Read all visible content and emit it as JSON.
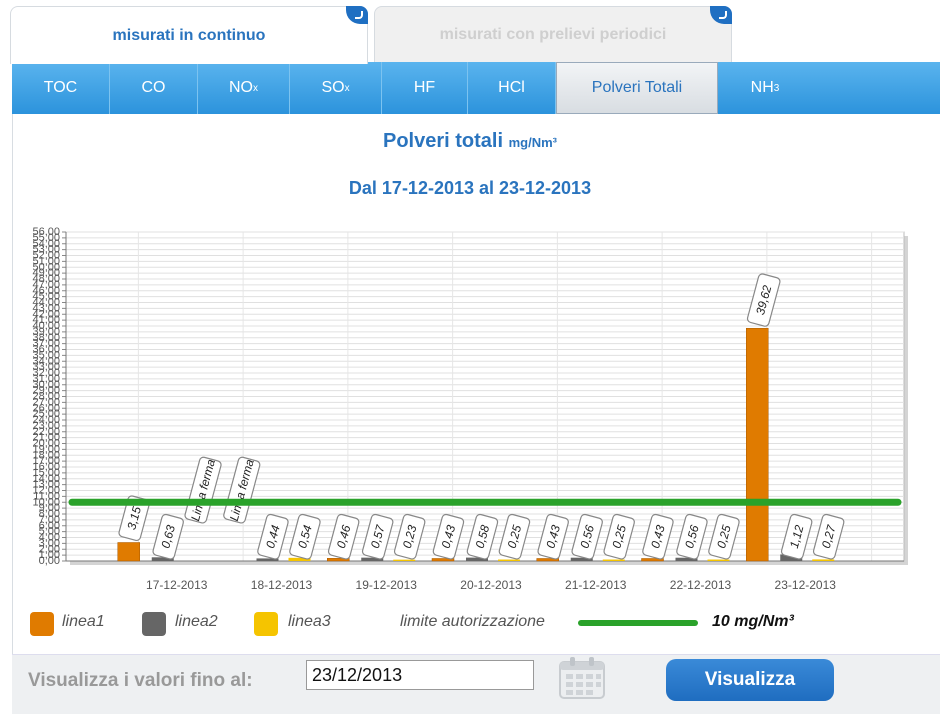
{
  "top_tabs": [
    {
      "label": "misurati in continuo",
      "active": true
    },
    {
      "label": "misurati con prelievi periodici",
      "active": false
    }
  ],
  "pollutants": [
    {
      "label": "TOC",
      "sub": ""
    },
    {
      "label": "CO",
      "sub": ""
    },
    {
      "label": "NO",
      "sub": "x"
    },
    {
      "label": "SO",
      "sub": "x"
    },
    {
      "label": "HF",
      "sub": ""
    },
    {
      "label": "HCl",
      "sub": ""
    },
    {
      "label": "Polveri Totali",
      "sub": "",
      "active": true
    },
    {
      "label": "NH",
      "sub": "3"
    }
  ],
  "chart_title": "Polveri totali",
  "chart_unit": "mg/Nm³",
  "chart_subtitle": "Dal 17-12-2013 al 23-12-2013",
  "legend": {
    "linea1": "linea1",
    "linea2": "linea2",
    "linea3": "linea3",
    "limit_label": "limite autorizzazione",
    "limit_value": "10 mg/Nm³"
  },
  "colors": {
    "linea1": "#e07b00",
    "linea2": "#666666",
    "linea3": "#f5c400",
    "limit": "#2aa22a",
    "accent": "#2a74be"
  },
  "bottom": {
    "label": "Visualizza i valori fino al:",
    "date": "23/12/2013",
    "button": "Visualizza"
  },
  "chart_data": {
    "type": "bar",
    "ylim": [
      0,
      56
    ],
    "y_ticks": [
      "0,00",
      "1,00",
      "2,00",
      "3,00",
      "4,00",
      "5,00",
      "6,00",
      "7,00",
      "8,00",
      "9,00",
      "10,00",
      "11,00",
      "12,00",
      "13,00",
      "14,00",
      "15,00",
      "16,00",
      "17,00",
      "18,00",
      "19,00",
      "20,00",
      "21,00",
      "22,00",
      "23,00",
      "24,00",
      "25,00",
      "26,00",
      "27,00",
      "28,00",
      "29,00",
      "30,00",
      "31,00",
      "32,00",
      "33,00",
      "34,00",
      "35,00",
      "36,00",
      "37,00",
      "38,00",
      "39,00",
      "40,00",
      "41,00",
      "42,00",
      "43,00",
      "44,00",
      "45,00",
      "46,00",
      "47,00",
      "48,00",
      "49,00",
      "50,00",
      "51,00",
      "52,00",
      "53,00",
      "54,00",
      "55,00",
      "56,00"
    ],
    "categories": [
      "17-12-2013",
      "18-12-2013",
      "19-12-2013",
      "20-12-2013",
      "21-12-2013",
      "22-12-2013",
      "23-12-2013"
    ],
    "series": [
      {
        "name": "linea1",
        "values": [
          3.15,
          null,
          0.46,
          0.43,
          0.43,
          0.43,
          39.62
        ],
        "labels": [
          "3,15",
          "Linea ferma",
          "0,46",
          "0,43",
          "0,43",
          "0,43",
          "39,62"
        ]
      },
      {
        "name": "linea2",
        "values": [
          0.63,
          0.44,
          0.57,
          0.58,
          0.56,
          0.56,
          1.12
        ],
        "labels": [
          "0,63",
          "0,44",
          "0,57",
          "0,58",
          "0,56",
          "0,56",
          "1,12"
        ]
      },
      {
        "name": "linea3",
        "values": [
          null,
          0.54,
          0.23,
          0.25,
          0.25,
          0.25,
          0.27
        ],
        "labels": [
          "Linea ferma",
          "0,54",
          "0,23",
          "0,25",
          "0,25",
          "0,25",
          "0,27"
        ]
      }
    ],
    "limit": {
      "name": "limite autorizzazione",
      "value": 10
    }
  }
}
